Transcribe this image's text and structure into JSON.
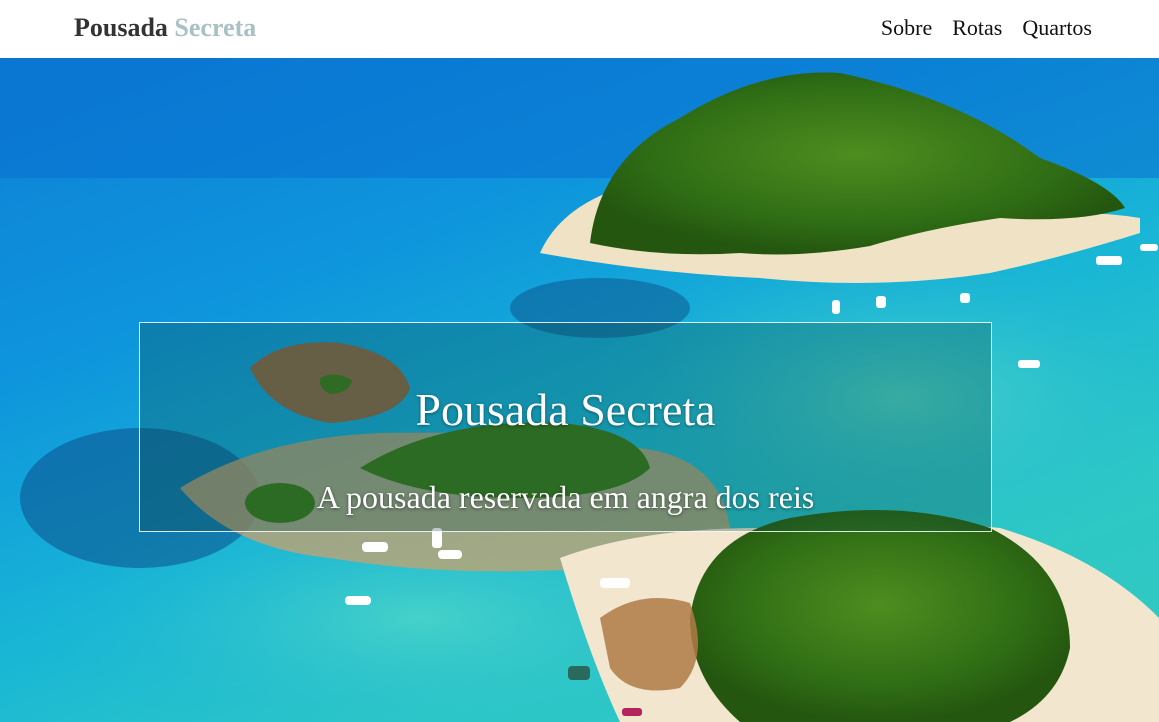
{
  "navbar": {
    "brand_primary": "Pousada",
    "brand_accent": "Secreta",
    "links": [
      "Sobre",
      "Rotas",
      "Quartos"
    ]
  },
  "hero": {
    "title": "Pousada Secreta",
    "subtitle": "A pousada reservada em angra dos reis",
    "image_subject": "aerial view of tropical islands with turquoise sea and boats"
  },
  "colors": {
    "brand_primary": "#333333",
    "brand_accent": "#a9c0c4",
    "nav_background": "#ffffff",
    "sea_deep": "#0d7fd6",
    "sea_shallow": "#34c9c0"
  }
}
